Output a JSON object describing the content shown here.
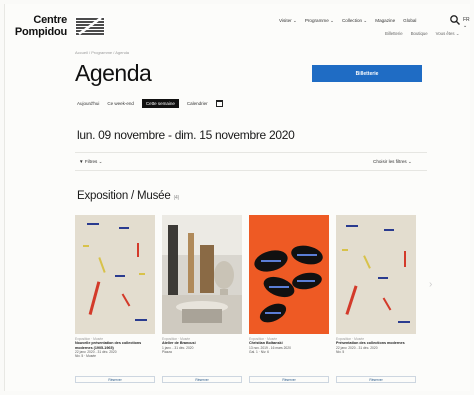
{
  "logo": {
    "line1": "Centre",
    "line2": "Pompidou"
  },
  "nav": {
    "items": [
      "Visiter ⌄",
      "Programme ⌄",
      "Collection ⌄",
      "Magazine",
      "Global",
      "⌄"
    ],
    "user": "FR ⌄",
    "subnav": [
      "Billetterie",
      "Boutique",
      "Vous êtes ⌄"
    ]
  },
  "breadcrumb": "Accueil / Programme / Agenda",
  "page_title": "Agenda",
  "cta_label": "Billetterie",
  "tabs": [
    "Aujourd'hui",
    "Ce week-end",
    "Cette semaine",
    "Calendrier"
  ],
  "date_range": "lun. 09 novembre - dim. 15 novembre 2020",
  "filters": {
    "left": "▼ Filtres ⌄",
    "right": "Choisir les filtres ⌄"
  },
  "section": {
    "title": "Exposition / Musée",
    "count": "(4)"
  },
  "cards": [
    {
      "meta": "Exposition · Musée",
      "name": "Nouvelle présentation des collections modernes (1905-1965)",
      "dates": "22 janv. 2020 - 31 déc. 2020",
      "extra": "Niv. 5 · Musée",
      "button": "Réserver"
    },
    {
      "meta": "Exposition · Musée",
      "name": "Atelier de Brancusi",
      "dates": "1 janv. - 31 déc. 2020",
      "extra": "Piazza",
      "button": "Réserver"
    },
    {
      "meta": "Exposition · Musée",
      "name": "Christian Boltanski",
      "dates": "13 nov. 2019 - 16 mars 2020",
      "extra": "Gal. 1 · Niv. 6",
      "button": "Réserver"
    },
    {
      "meta": "Exposition · Musée",
      "name": "Présentation des collections modernes",
      "dates": "22 janv. 2020 - 31 déc. 2020",
      "extra": "Niv. 5",
      "button": "Réserver"
    }
  ],
  "colors": {
    "accent": "#1f6cc4",
    "poster_orange": "#ee5a24"
  }
}
